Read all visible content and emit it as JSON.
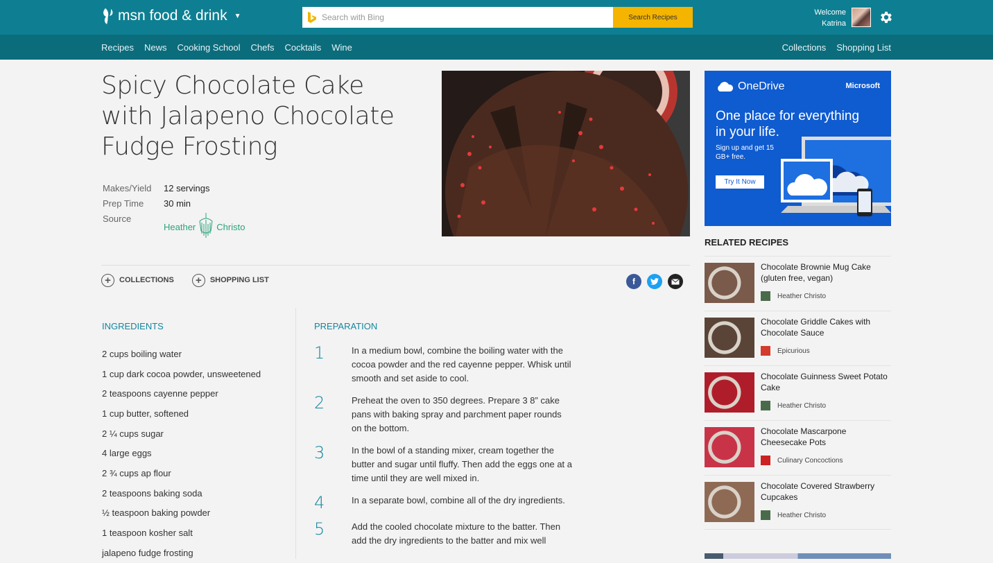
{
  "header": {
    "brand": "msn food & drink",
    "search_placeholder": "Search with Bing",
    "search_button": "Search Recipes",
    "welcome_line1": "Welcome",
    "welcome_line2": "Katrina"
  },
  "nav": {
    "left": [
      "Recipes",
      "News",
      "Cooking School",
      "Chefs",
      "Cocktails",
      "Wine"
    ],
    "right": [
      "Collections",
      "Shopping List"
    ]
  },
  "recipe": {
    "title": "Spicy Chocolate Cake with Jalapeno Chocolate Fudge Frosting",
    "makes_label": "Makes/Yield",
    "makes_value": "12 servings",
    "prep_label": "Prep Time",
    "prep_value": "30 min",
    "source_label": "Source",
    "source_logo_text_left": "Heather",
    "source_logo_text_right": "Christo"
  },
  "actions": {
    "collections": "COLLECTIONS",
    "shopping_list": "SHOPPING LIST"
  },
  "ingredients": {
    "heading": "INGREDIENTS",
    "items": [
      "2 cups boiling water",
      "1 cup dark cocoa powder, unsweetened",
      "2 teaspoons cayenne pepper",
      "1 cup butter, softened",
      "2 ¼ cups sugar",
      "4 large eggs",
      "2 ¾ cups ap flour",
      "2 teaspoons baking soda",
      "½ teaspoon baking powder",
      "1 teaspoon kosher salt",
      "jalapeno fudge frosting"
    ]
  },
  "preparation": {
    "heading": "PREPARATION",
    "steps": [
      {
        "n": "1",
        "text": "In a medium bowl, combine the boiling water with the cocoa powder and the red cayenne pepper. Whisk until smooth and set aside to cool."
      },
      {
        "n": "2",
        "text": "Preheat the oven to 350 degrees. Prepare 3 8” cake pans with baking spray and parchment paper rounds on the bottom."
      },
      {
        "n": "3",
        "text": "In the bowl of a standing mixer, cream together the butter and sugar until fluffy. Then add the eggs one at a time until they are well mixed in."
      },
      {
        "n": "4",
        "text": "In a separate bowl, combine all of the dry ingredients."
      },
      {
        "n": "5",
        "text": "Add the cooled chocolate mixture to the batter. Then add the dry ingredients to the batter and mix well"
      }
    ]
  },
  "ad": {
    "product": "OneDrive",
    "company": "Microsoft",
    "headline": "One place for everything in your life.",
    "sub": "Sign up and get 15 GB+ free.",
    "button": "Try It Now"
  },
  "related": {
    "heading": "RELATED RECIPES",
    "items": [
      {
        "title": "Chocolate Brownie Mug Cake (gluten free, vegan)",
        "source": "Heather Christo",
        "thumb": "#7a5a4a",
        "icon": "#4a6b4a"
      },
      {
        "title": "Chocolate Griddle Cakes with Chocolate Sauce",
        "source": "Epicurious",
        "thumb": "#5a4438",
        "icon": "#d23b2e"
      },
      {
        "title": "Chocolate Guinness Sweet Potato Cake",
        "source": "Heather Christo",
        "thumb": "#b01d2a",
        "icon": "#4a6b4a"
      },
      {
        "title": "Chocolate Mascarpone Cheesecake Pots",
        "source": "Culinary Concoctions",
        "thumb": "#c93348",
        "icon": "#c22"
      },
      {
        "title": "Chocolate Covered Strawberry Cupcakes",
        "source": "Heather Christo",
        "thumb": "#8e6a55",
        "icon": "#4a6b4a"
      }
    ]
  }
}
